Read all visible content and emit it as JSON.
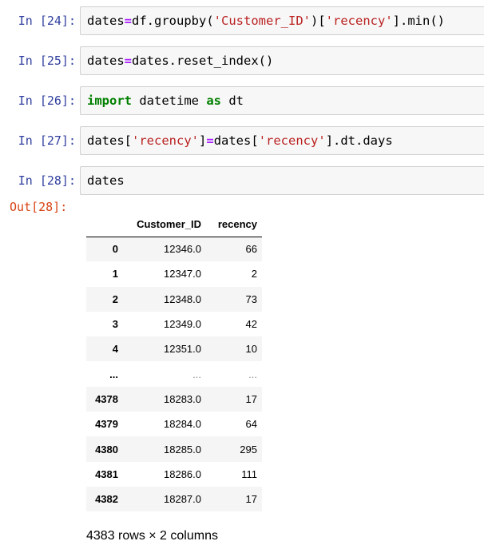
{
  "cells": [
    {
      "prompt": "In [24]:"
    },
    {
      "prompt": "In [25]:"
    },
    {
      "prompt": "In [26]:"
    },
    {
      "prompt": "In [27]:"
    },
    {
      "prompt": "In [28]:"
    }
  ],
  "code": {
    "c24": {
      "a": "dates",
      "eq": "=",
      "b": "df.groupby(",
      "s1": "'Customer_ID'",
      "c": ")[",
      "s2": "'recency'",
      "d": "].min()"
    },
    "c25": {
      "a": "dates",
      "eq": "=",
      "b": "dates.reset_index()"
    },
    "c26": {
      "kw1": "import",
      "b": " datetime ",
      "kw2": "as",
      "c": " dt"
    },
    "c27": {
      "a": "dates[",
      "s1": "'recency'",
      "b": "]",
      "eq": "=",
      "c": "dates[",
      "s2": "'recency'",
      "d": "].dt.days"
    },
    "c28": {
      "a": "dates"
    }
  },
  "output": {
    "prompt": "Out[28]:",
    "table": {
      "columns": [
        "",
        "Customer_ID",
        "recency"
      ],
      "rows": [
        {
          "index": "0",
          "customer_id": "12346.0",
          "recency": "66"
        },
        {
          "index": "1",
          "customer_id": "12347.0",
          "recency": "2"
        },
        {
          "index": "2",
          "customer_id": "12348.0",
          "recency": "73"
        },
        {
          "index": "3",
          "customer_id": "12349.0",
          "recency": "42"
        },
        {
          "index": "4",
          "customer_id": "12351.0",
          "recency": "10"
        },
        {
          "index": "...",
          "customer_id": "...",
          "recency": "..."
        },
        {
          "index": "4378",
          "customer_id": "18283.0",
          "recency": "17"
        },
        {
          "index": "4379",
          "customer_id": "18284.0",
          "recency": "64"
        },
        {
          "index": "4380",
          "customer_id": "18285.0",
          "recency": "295"
        },
        {
          "index": "4381",
          "customer_id": "18286.0",
          "recency": "111"
        },
        {
          "index": "4382",
          "customer_id": "18287.0",
          "recency": "17"
        }
      ]
    },
    "footer": "4383 rows × 2 columns"
  }
}
